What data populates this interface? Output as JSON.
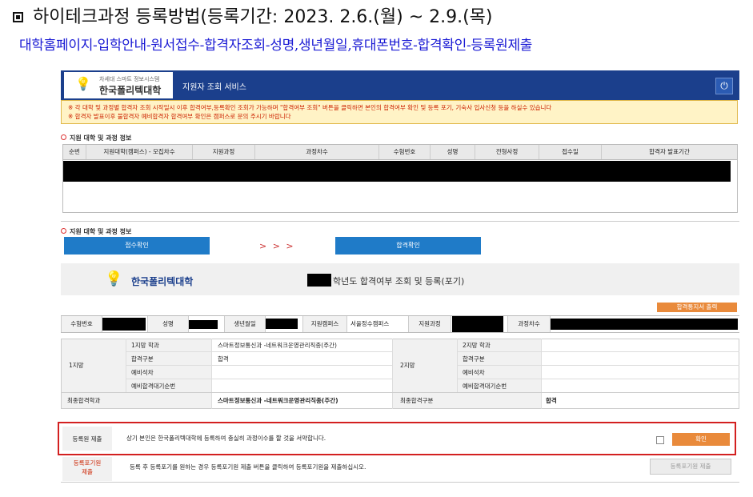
{
  "doc": {
    "title": "하이테크과정 등록방법(등록기간: 2023. 2.6.(월) ~ 2.9.(목)",
    "steps": "대학홈페이지-입학안내-원서접수-합격자조회-성명,생년월일,휴대폰번호-합격확인-등록원제출"
  },
  "header": {
    "logo_sub": "차세대 스마트 정보시스템",
    "logo_main": "한국폴리텍대학",
    "title": "지원자 조회 서비스",
    "power_icon": "power-icon"
  },
  "notice": {
    "line1": "※ 각 대학 및 과정별 합격자 조회 시작일시 이후 합격여부,등록확인 조회가 가능하며 \"합격여부 조회\" 버튼을 클릭하면 본인의 합격여부 확인 및 등록 포기, 기숙사 입사신청 등을 하실수 있습니다",
    "line2": "※ 합격자 발표이후 불합격자 예비합격자 합격여부 확인은 캠퍼스로 문의 주시기 바랍니다"
  },
  "section1": {
    "title": "지원 대학 및 과정 정보",
    "columns": [
      "순번",
      "지원대학(캠퍼스) - 모집차수",
      "지원과정",
      "과정차수",
      "수험번호",
      "성명",
      "전형사정",
      "접수일",
      "합격자 발표기간"
    ]
  },
  "section2": {
    "title": "지원 대학 및 과정 정보",
    "btn_receipt": "접수확인",
    "arrows": "> > >",
    "btn_pass": "합격확인"
  },
  "banner": {
    "logo": "한국폴리텍대학",
    "title": "학년도 합격여부 조회 및 등록(포기)"
  },
  "print_button": "합격통지서 출력",
  "info": {
    "exam_no_label": "수험번호",
    "name_label": "성명",
    "birth_label": "생년월일",
    "campus_label": "지원캠퍼스",
    "campus_value": "서울정수캠퍼스",
    "course_label": "지원과정",
    "round_label": "과정차수"
  },
  "choice1": {
    "group_label": "1지망",
    "dept_label": "1지망 학과",
    "dept_value": "스마트정보통신과 -네트워크운영관리직종(주간)",
    "pass_type_label": "합격구분",
    "pass_type_value": "합격",
    "wait_rank_label": "예비석차",
    "wait_order_label": "예비합격대기순번"
  },
  "choice2": {
    "group_label": "2지망",
    "dept_label": "2지망 학과",
    "pass_type_label": "합격구분",
    "wait_rank_label": "예비석차",
    "wait_order_label": "예비합격대기순번"
  },
  "final": {
    "dept_label": "최종합격학과",
    "dept_value": "스마트정보통신과 -네트워크운영관리직종(주간)",
    "type_label": "최종합격구분",
    "type_value": "합격"
  },
  "agree": {
    "label": "등록원 제출",
    "text": "상기 본인은 한국폴리텍대학에 등록하여 충실히 과정이수를 할 것을 서약합니다.",
    "confirm_button": "확인"
  },
  "giveup": {
    "label1": "등록포기원",
    "label2": "제출",
    "text": "등록 후 등록포기를 원하는 경우 등록포기원 제출 버튼을 클릭하여 등록포기원을 제출하십시오.",
    "button": "등록포기원 제출"
  }
}
